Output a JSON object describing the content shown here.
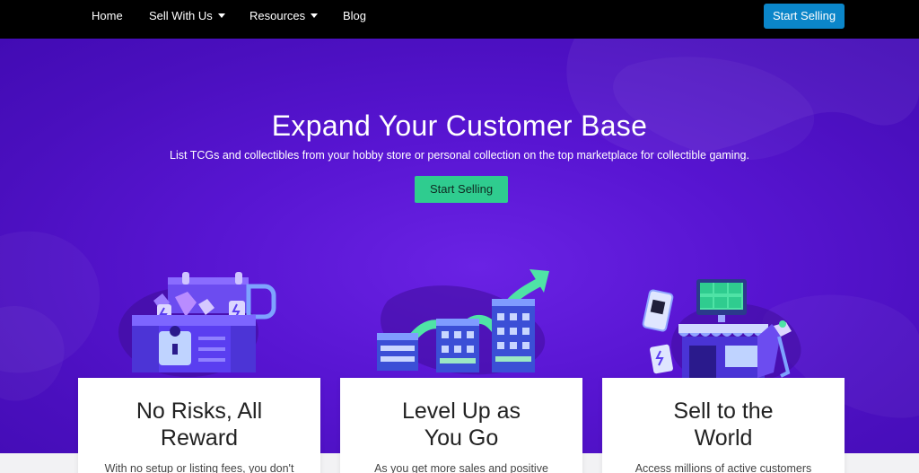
{
  "nav": {
    "items": [
      {
        "label": "Home"
      },
      {
        "label": "Sell With Us"
      },
      {
        "label": "Resources"
      },
      {
        "label": "Blog"
      }
    ],
    "cta_label": "Start Selling"
  },
  "hero": {
    "title": "Expand Your Customer Base",
    "subtitle": "List TCGs and collectibles from your hobby store or personal collection on the top marketplace for collectible gaming.",
    "cta_label": "Start Selling"
  },
  "features": [
    {
      "title": "No Risks, All Reward",
      "body": "With no setup or listing fees, you don't"
    },
    {
      "title": "Level Up as You Go",
      "body": "As you get more sales and positive"
    },
    {
      "title": "Sell to the World",
      "body": "Access millions of active customers"
    }
  ],
  "colors": {
    "nav_bg": "#000000",
    "nav_cta": "#0b86c9",
    "hero_bg": "#5815d2",
    "hero_cta": "#2fcc8f",
    "card_bg": "#ffffff"
  },
  "icons": [
    "treasure-chest-icon",
    "growth-chart-icon",
    "global-store-icon"
  ]
}
